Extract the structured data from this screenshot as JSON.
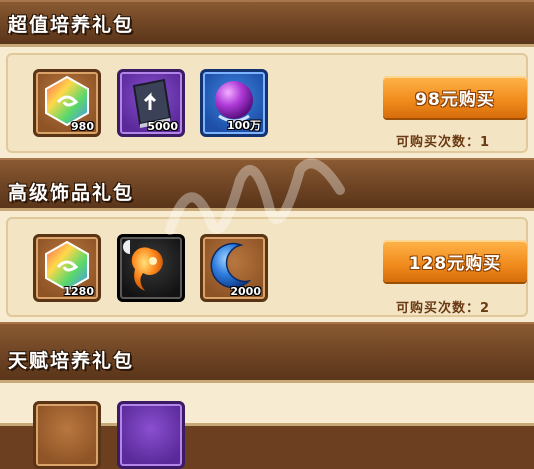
{
  "sections": [
    {
      "title": "超值培养礼包",
      "buy_label": "98元购买",
      "count_text": "可购买次数：1",
      "items": [
        {
          "icon": "rainbow-hexagon-gem-icon",
          "qty": "980"
        },
        {
          "icon": "arrow-book-icon",
          "qty": "5000"
        },
        {
          "icon": "purple-orb-icon",
          "qty": "100万"
        }
      ]
    },
    {
      "title": "高级饰品礼包",
      "buy_label": "128元购买",
      "count_text": "可购买次数：2",
      "items": [
        {
          "icon": "rainbow-hexagon-gem-icon",
          "qty": "1280"
        },
        {
          "icon": "orange-magatama-icon",
          "qty": ""
        },
        {
          "icon": "blue-crescent-icon",
          "qty": "2000"
        }
      ]
    },
    {
      "title": "天赋培养礼包",
      "items": []
    }
  ],
  "colors": {
    "button": "#f08a1c",
    "panel": "#f7ecd2",
    "bar": "#6e4424"
  }
}
